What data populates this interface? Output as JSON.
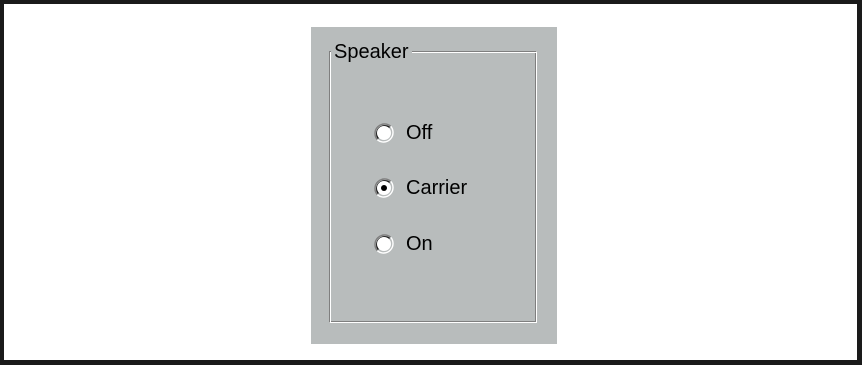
{
  "speaker_group": {
    "title": "Speaker",
    "options": [
      {
        "label": "Off",
        "selected": false
      },
      {
        "label": "Carrier",
        "selected": true
      },
      {
        "label": "On",
        "selected": false
      }
    ]
  },
  "colors": {
    "panel_background": "#b8bcbc",
    "frame_border": "#1a1a1a",
    "page_background": "#ffffff"
  }
}
